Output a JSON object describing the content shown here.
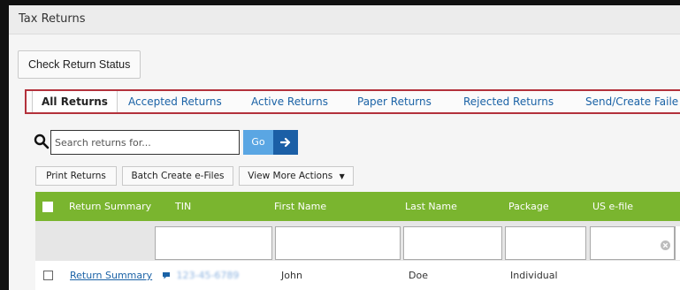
{
  "window": {
    "title": "Tax Returns"
  },
  "actions": {
    "check_status": "Check Return Status"
  },
  "tabs": [
    {
      "label": "All Returns",
      "active": true
    },
    {
      "label": "Accepted Returns",
      "active": false
    },
    {
      "label": "Active Returns",
      "active": false
    },
    {
      "label": "Paper Returns",
      "active": false
    },
    {
      "label": "Rejected Returns",
      "active": false
    },
    {
      "label": "Send/Create Faile",
      "active": false
    }
  ],
  "search": {
    "placeholder": "Search returns for...",
    "go_label": "Go"
  },
  "toolbar": {
    "print_label": "Print Returns",
    "batch_label": "Batch Create e-Files",
    "more_label": "View More Actions"
  },
  "table": {
    "columns": [
      "Return Summary",
      "TIN",
      "First Name",
      "Last Name",
      "Package",
      "US e-file"
    ],
    "rows": [
      {
        "summary": "Return Summary",
        "tin": "123-45-6789",
        "first_name": "John",
        "last_name": "Doe",
        "package": "Individual"
      }
    ]
  },
  "colors": {
    "accent_green": "#7ab52f",
    "tab_outline": "#b3313b",
    "link_blue": "#1a62a6",
    "go_blue": "#5aa6e3",
    "arrow_blue": "#1b5fa6"
  }
}
